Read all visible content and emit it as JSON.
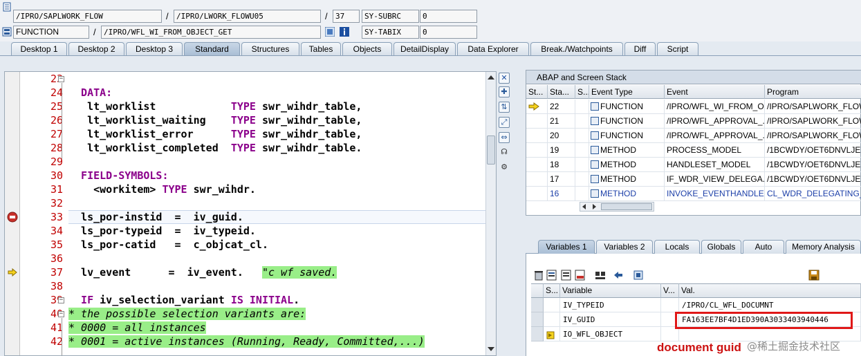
{
  "header": {
    "row1": {
      "program": "/IPRO/SAPLWORK_FLOW",
      "include": "/IPRO/LWORK_FLOWU05",
      "line": "37",
      "sysvar_name": "SY-SUBRC",
      "sysvar_value": "0"
    },
    "row2": {
      "event_type": "FUNCTION",
      "event": "/IPRO/WFL_WI_FROM_OBJECT_GET",
      "sysvar_name": "SY-TABIX",
      "sysvar_value": "0"
    },
    "separator": "/"
  },
  "tabs": [
    "Desktop 1",
    "Desktop 2",
    "Desktop 3",
    "Standard",
    "Structures",
    "Tables",
    "Objects",
    "DetailDisplay",
    "Data Explorer",
    "Break./Watchpoints",
    "Diff",
    "Script"
  ],
  "active_tab": "Standard",
  "code": {
    "line_numbers": [
      "23",
      "24",
      "25",
      "26",
      "27",
      "28",
      "29",
      "30",
      "31",
      "32",
      "33",
      "34",
      "35",
      "36",
      "37",
      "38",
      "39",
      "40",
      "41",
      "42"
    ],
    "lines": [
      {
        "segs": [
          {
            "t": "",
            "c": ""
          }
        ]
      },
      {
        "segs": [
          {
            "t": "  DATA:",
            "c": "kw"
          }
        ]
      },
      {
        "segs": [
          {
            "t": "   lt_worklist            ",
            "c": ""
          },
          {
            "t": "TYPE",
            "c": "kw"
          },
          {
            "t": " swr_wihdr_table,",
            "c": ""
          }
        ]
      },
      {
        "segs": [
          {
            "t": "   lt_worklist_waiting    ",
            "c": ""
          },
          {
            "t": "TYPE",
            "c": "kw"
          },
          {
            "t": " swr_wihdr_table,",
            "c": ""
          }
        ]
      },
      {
        "segs": [
          {
            "t": "   lt_worklist_error      ",
            "c": ""
          },
          {
            "t": "TYPE",
            "c": "kw"
          },
          {
            "t": " swr_wihdr_table,",
            "c": ""
          }
        ]
      },
      {
        "segs": [
          {
            "t": "   lt_worklist_completed  ",
            "c": ""
          },
          {
            "t": "TYPE",
            "c": "kw"
          },
          {
            "t": " swr_wihdr_table.",
            "c": ""
          }
        ]
      },
      {
        "segs": [
          {
            "t": "",
            "c": ""
          }
        ]
      },
      {
        "segs": [
          {
            "t": "  FIELD-SYMBOLS:",
            "c": "kw"
          }
        ]
      },
      {
        "segs": [
          {
            "t": "    <workitem> ",
            "c": ""
          },
          {
            "t": "TYPE",
            "c": "kw"
          },
          {
            "t": " swr_wihdr.",
            "c": ""
          }
        ]
      },
      {
        "segs": [
          {
            "t": "",
            "c": ""
          }
        ]
      },
      {
        "segs": [
          {
            "t": "  ls_por-instid  =  iv_guid.",
            "c": ""
          }
        ]
      },
      {
        "segs": [
          {
            "t": "  ls_por-typeid  =  iv_typeid.",
            "c": ""
          }
        ]
      },
      {
        "segs": [
          {
            "t": "  ls_por-catid   =  c_objcat_cl.",
            "c": ""
          }
        ]
      },
      {
        "segs": [
          {
            "t": "",
            "c": ""
          }
        ]
      },
      {
        "segs": [
          {
            "t": "  lv_event      =  iv_event.   ",
            "c": ""
          },
          {
            "t": "\"c wf saved.",
            "c": "str"
          }
        ]
      },
      {
        "segs": [
          {
            "t": "",
            "c": ""
          }
        ]
      },
      {
        "segs": [
          {
            "t": "  IF",
            "c": "kw"
          },
          {
            "t": " iv_selection_variant ",
            "c": ""
          },
          {
            "t": "IS INITIAL",
            "c": "kw"
          },
          {
            "t": ".",
            "c": ""
          }
        ]
      },
      {
        "segs": [
          {
            "t": "* the possible selection variants are:",
            "c": "cm cmbg"
          }
        ]
      },
      {
        "segs": [
          {
            "t": "* 0000 = all instances",
            "c": "cm cmbg"
          }
        ]
      },
      {
        "segs": [
          {
            "t": "* 0001 = active instances (Running, Ready, Committed,...)",
            "c": "cm cmbg"
          }
        ]
      }
    ]
  },
  "stack": {
    "title": "ABAP and Screen Stack",
    "columns": [
      "St...",
      "Sta...",
      "S...",
      "Event Type",
      "Event",
      "Program"
    ],
    "rows": [
      {
        "level": "22",
        "type": "FUNCTION",
        "event": "/IPRO/WFL_WI_FROM_O...",
        "program": "/IPRO/SAPLWORK_FLOW",
        "current": true
      },
      {
        "level": "21",
        "type": "FUNCTION",
        "event": "/IPRO/WFL_APPROVAL_...",
        "program": "/IPRO/SAPLWORK_FLOW",
        "current": false
      },
      {
        "level": "20",
        "type": "FUNCTION",
        "event": "/IPRO/WFL_APPROVAL_...",
        "program": "/IPRO/SAPLWORK_FLOW",
        "current": false
      },
      {
        "level": "19",
        "type": "METHOD",
        "event": "PROCESS_MODEL",
        "program": "/1BCWDY/OET6DNVLJE...",
        "current": false
      },
      {
        "level": "18",
        "type": "METHOD",
        "event": "HANDLESET_MODEL",
        "program": "/1BCWDY/OET6DNVLJE...",
        "current": false
      },
      {
        "level": "17",
        "type": "METHOD",
        "event": "IF_WDR_VIEW_DELEGA...",
        "program": "/1BCWDY/OET6DNVLJE...",
        "current": false
      },
      {
        "level": "16",
        "type": "METHOD",
        "event": "INVOKE_EVENTHANDLER",
        "program": "CL_WDR_DELEGATING_...",
        "current": false
      }
    ]
  },
  "variables": {
    "tabs": [
      "Variables 1",
      "Variables 2",
      "Locals",
      "Globals",
      "Auto",
      "Memory Analysis"
    ],
    "active_tab": "Variables 1",
    "columns": [
      "S...",
      "Variable",
      "V...",
      "Val."
    ],
    "rows": [
      {
        "variable": "IV_TYPEID",
        "value": "/IPRO/CL_WFL_DOCUMNT"
      },
      {
        "variable": "IV_GUID",
        "value": "FA163EE7BF4D1ED390A3033403940446"
      },
      {
        "variable": "IO_WFL_OBJECT",
        "value": ""
      }
    ]
  },
  "annotation": "document guid",
  "watermark": "@稀土掘金技术社区",
  "colors": {
    "keyword": "#8b008b",
    "line_number": "#c00000",
    "comment_bg": "#99ee88",
    "highlight_box": "#e01818"
  }
}
